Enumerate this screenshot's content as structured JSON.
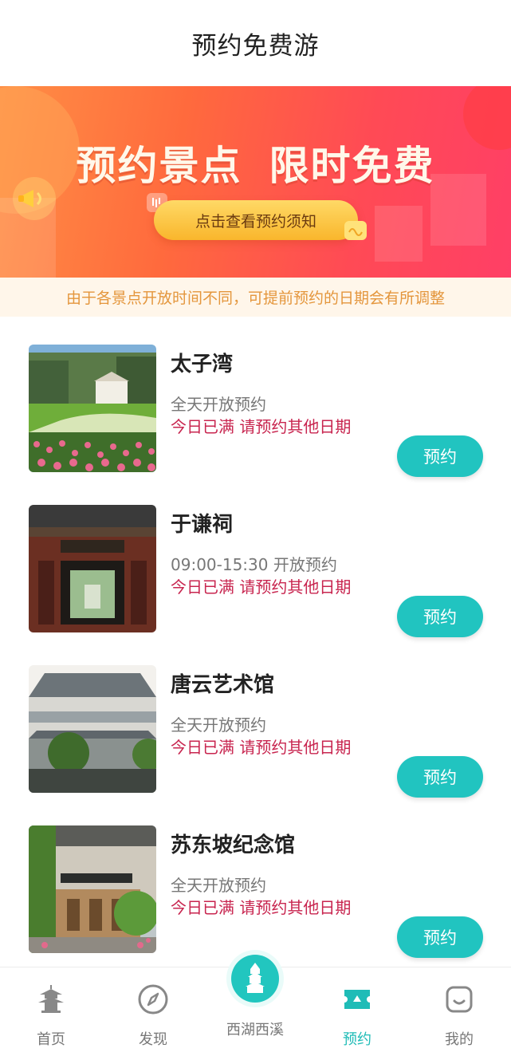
{
  "header": {
    "title": "预约免费游"
  },
  "banner": {
    "headline_left": "预约景点",
    "headline_right": "限时免费",
    "notice_button": "点击查看预约须知",
    "tip": "由于各景点开放时间不同，可提前预约的日期会有所调整"
  },
  "attractions": [
    {
      "name": "太子湾",
      "hours": "全天开放预约",
      "status": "今日已满 请预约其他日期",
      "button": "预约"
    },
    {
      "name": "于谦祠",
      "hours": "09:00-15:30 开放预约",
      "status": "今日已满 请预约其他日期",
      "button": "预约"
    },
    {
      "name": "唐云艺术馆",
      "hours": "全天开放预约",
      "status": "今日已满 请预约其他日期",
      "button": "预约"
    },
    {
      "name": "苏东坡纪念馆",
      "hours": "全天开放预约",
      "status": "今日已满 请预约其他日期",
      "button": "预约"
    }
  ],
  "tabbar": {
    "tabs": [
      {
        "label": "首页",
        "icon": "pagoda-icon"
      },
      {
        "label": "发现",
        "icon": "compass-icon"
      },
      {
        "label": "西湖西溪",
        "icon": "tower-icon"
      },
      {
        "label": "预约",
        "icon": "ticket-icon",
        "active": true
      },
      {
        "label": "我的",
        "icon": "profile-icon"
      }
    ]
  },
  "colors": {
    "accent": "#21c4c0",
    "status_red": "#c8254f",
    "tip_text": "#e4963c",
    "banner_start": "#ff8f45",
    "banner_end": "#ff3f66"
  }
}
